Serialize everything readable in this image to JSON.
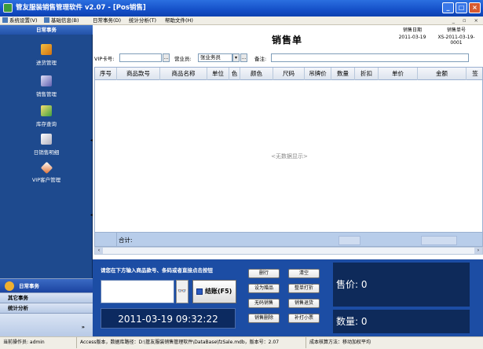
{
  "window": {
    "title": "管友服装销售管理软件 v2.07 - [Pos销售]"
  },
  "menu": [
    {
      "label": "系统设置(V)"
    },
    {
      "label": "基础信息(B)"
    },
    {
      "label": "日常事务(D)"
    },
    {
      "label": "统计分析(T)"
    },
    {
      "label": "帮助文件(H)"
    }
  ],
  "mdi_controls": "_ ▫ ×",
  "sidebar": {
    "header": "日常事务",
    "items": [
      {
        "label": "进货管理",
        "icon": "purchase-icon"
      },
      {
        "label": "销售管理",
        "icon": "sales-icon"
      },
      {
        "label": "库存查询",
        "icon": "inventory-icon"
      },
      {
        "label": "日销售明细",
        "icon": "daily-sales-icon"
      },
      {
        "label": "VIP客户管理",
        "icon": "vip-icon"
      }
    ],
    "sections": [
      {
        "label": "日常事务"
      },
      {
        "label": "其它事务"
      },
      {
        "label": "统计分析"
      }
    ],
    "more_arrow": "»"
  },
  "doc": {
    "title": "销售单",
    "date_label": "销售日期",
    "date_value": "2011-03-19",
    "no_label": "销售单号",
    "no_value": "XS-2011-03-19-0001"
  },
  "form": {
    "vip_label": "VIP卡号:",
    "vip_value": "",
    "clerk_label": "营业员:",
    "clerk_value": "张业务员",
    "note_label": "备注:",
    "note_value": ""
  },
  "table": {
    "columns": [
      "序号",
      "商品款号",
      "商品名称",
      "单位",
      "色",
      "颜色",
      "尺码",
      "吊牌价",
      "数量",
      "折扣",
      "单价",
      "金额",
      "签"
    ],
    "empty_text": "<无数据显示>",
    "total_label": "合计:"
  },
  "bottom": {
    "prompt": "请您在下方输入商品款号、条码或者直接点击按钮",
    "search_value": "",
    "settle_label": "结账(F5)",
    "datetime": "2011-03-19 09:32:22",
    "buttons": [
      {
        "label": "删行"
      },
      {
        "label": "清空"
      },
      {
        "label": "设为赠品"
      },
      {
        "label": "整单打折"
      },
      {
        "label": "无码销售"
      },
      {
        "label": "销售退货"
      },
      {
        "label": "销售删除"
      },
      {
        "label": "补打小票"
      }
    ],
    "price_label": "售价: 0",
    "qty_label": "数量: 0"
  },
  "status": {
    "operator": "当前操作员: admin",
    "db": "Access版本，数据库路径：D:\\管友服装销售管理软件\\DataBase\\fzSale.mdb，版本号：2.07",
    "cost": "成本核算方法：移动加权平均"
  },
  "colors": {
    "sidebar": "#1e4a8e",
    "bottom": "#1c4da4",
    "display": "#0e2a5a"
  }
}
